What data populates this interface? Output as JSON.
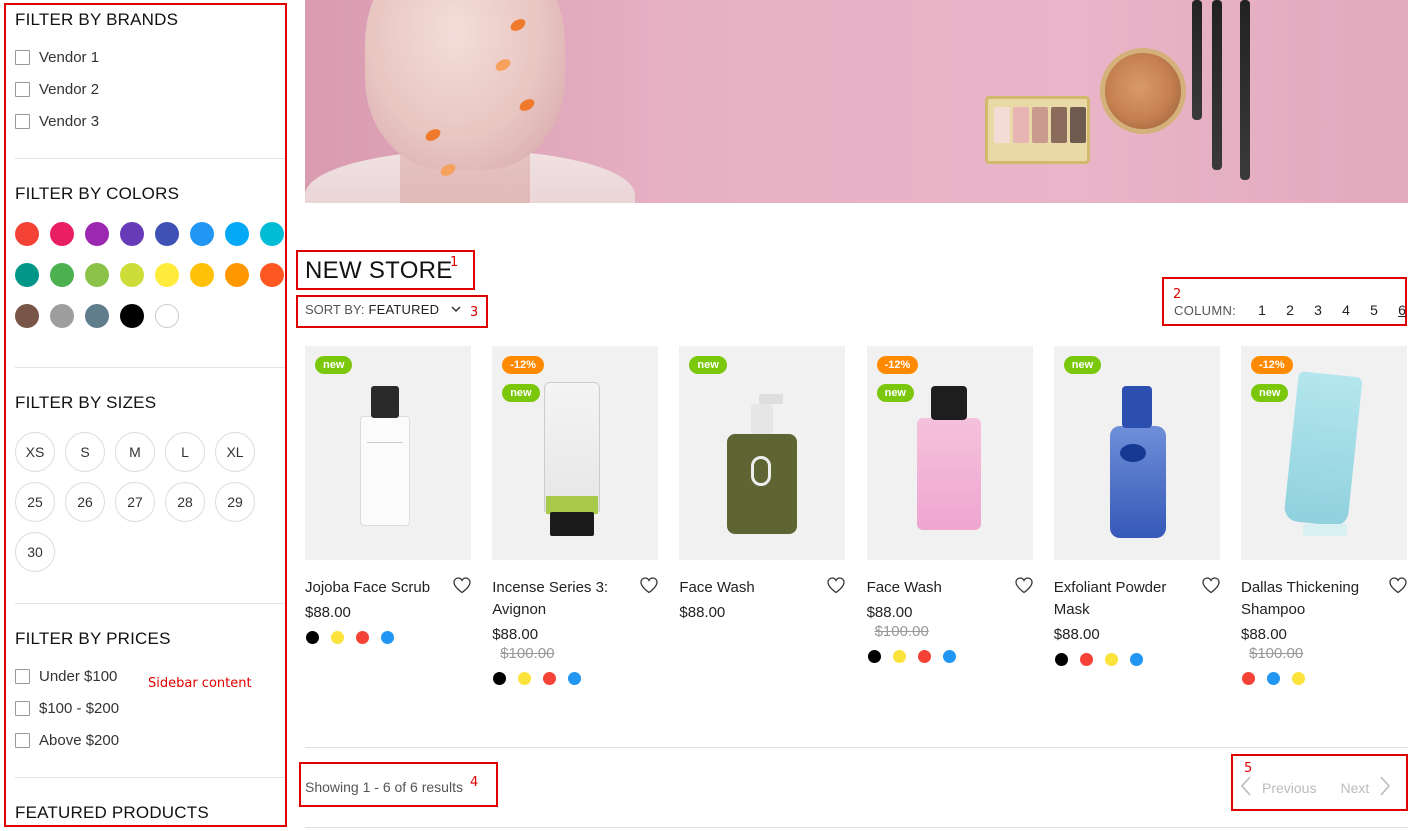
{
  "sidebar": {
    "brands": {
      "title": "FILTER BY BRANDS",
      "items": [
        "Vendor 1",
        "Vendor 2",
        "Vendor 3"
      ]
    },
    "colors": {
      "title": "FILTER BY COLORS",
      "swatches": [
        "#f44336",
        "#e91e63",
        "#9c27b0",
        "#673ab7",
        "#3f51b5",
        "#2196f3",
        "#03a9f4",
        "#00bcd4",
        "#009688",
        "#4caf50",
        "#8bc34a",
        "#cddc39",
        "#ffeb3b",
        "#ffc107",
        "#ff9800",
        "#ff5722",
        "#795548",
        "#9e9e9e",
        "#607d8b",
        "#000000",
        "#ffffff"
      ]
    },
    "sizes": {
      "title": "FILTER BY SIZES",
      "items": [
        "XS",
        "S",
        "M",
        "L",
        "XL",
        "25",
        "26",
        "27",
        "28",
        "29",
        "30"
      ]
    },
    "prices": {
      "title": "FILTER BY PRICES",
      "items": [
        "Under $100",
        "$100 - $200",
        "Above $200"
      ]
    },
    "featured": {
      "title": "FEATURED PRODUCTS"
    },
    "note": "Sidebar content"
  },
  "store": {
    "title": "NEW STORE"
  },
  "sort": {
    "label": "SORT BY:",
    "value": "FEATURED"
  },
  "columns": {
    "label": "COLUMN:",
    "options": [
      "1",
      "2",
      "3",
      "4",
      "5",
      "6"
    ],
    "active": "6"
  },
  "annotations": [
    "1",
    "2",
    "3",
    "4",
    "5"
  ],
  "products": [
    {
      "name": "Jojoba Face Scrub",
      "price": "$88.00",
      "old_price": "",
      "badges": [
        "new"
      ],
      "colors": [
        "#000000",
        "#fbe33b",
        "#f44336",
        "#2196f3"
      ]
    },
    {
      "name": "Incense Series 3: Avignon",
      "price": "$88.00",
      "old_price": "$100.00",
      "badges": [
        "-12%",
        "new"
      ],
      "colors": [
        "#000000",
        "#fbe33b",
        "#f44336",
        "#2196f3"
      ]
    },
    {
      "name": "Face Wash",
      "price": "$88.00",
      "old_price": "",
      "badges": [
        "new"
      ],
      "colors": []
    },
    {
      "name": "Face Wash",
      "price": "$88.00",
      "old_price": "$100.00",
      "badges": [
        "-12%",
        "new"
      ],
      "colors": [
        "#000000",
        "#fbe33b",
        "#f44336",
        "#2196f3"
      ]
    },
    {
      "name": "Exfoliant Powder Mask",
      "price": "$88.00",
      "old_price": "",
      "badges": [
        "new"
      ],
      "colors": [
        "#000000",
        "#f44336",
        "#fbe33b",
        "#2196f3"
      ]
    },
    {
      "name": "Dallas Thickening Shampoo",
      "price": "$88.00",
      "old_price": "$100.00",
      "badges": [
        "-12%",
        "new"
      ],
      "colors": [
        "#f44336",
        "#2196f3",
        "#fbe33b"
      ]
    }
  ],
  "results": {
    "text": "Showing 1 - 6 of 6 results"
  },
  "pagination": {
    "previous": "Previous",
    "next": "Next"
  },
  "accent": {
    "annotation_red": "#e00000",
    "badge_new": "#7ac70c",
    "badge_sale": "#ff8a00"
  }
}
